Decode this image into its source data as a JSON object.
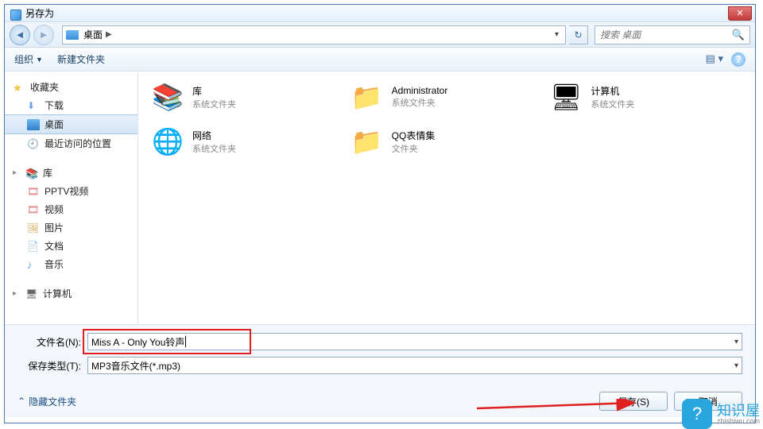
{
  "window": {
    "title": "另存为"
  },
  "nav": {
    "crumb": "桌面",
    "sep": "▶",
    "search_placeholder": "搜索 桌面"
  },
  "toolbar": {
    "organize": "组织",
    "new_folder": "新建文件夹"
  },
  "sidebar": {
    "favorites": {
      "label": "收藏夹",
      "items": [
        {
          "label": "下载"
        },
        {
          "label": "桌面"
        },
        {
          "label": "最近访问的位置"
        }
      ]
    },
    "libraries": {
      "label": "库",
      "items": [
        {
          "label": "PPTV视频"
        },
        {
          "label": "视频"
        },
        {
          "label": "图片"
        },
        {
          "label": "文档"
        },
        {
          "label": "音乐"
        }
      ]
    },
    "computer": {
      "label": "计算机"
    }
  },
  "tiles": [
    {
      "name": "库",
      "sub": "系统文件夹",
      "icon": "library"
    },
    {
      "name": "Administrator",
      "sub": "系统文件夹",
      "icon": "user"
    },
    {
      "name": "计算机",
      "sub": "系统文件夹",
      "icon": "computer"
    },
    {
      "name": "网络",
      "sub": "系统文件夹",
      "icon": "network"
    },
    {
      "name": "QQ表情集",
      "sub": "文件夹",
      "icon": "folder"
    }
  ],
  "footer": {
    "filename_label": "文件名(N):",
    "filename_value": "Miss A - Only You铃声",
    "filetype_label": "保存类型(T):",
    "filetype_value": "MP3音乐文件(*.mp3)",
    "hide_folders": "隐藏文件夹",
    "save": "保存(S)",
    "cancel": "取消"
  },
  "watermark": {
    "brand": "知识屋",
    "url": "zhishiwu.com"
  }
}
